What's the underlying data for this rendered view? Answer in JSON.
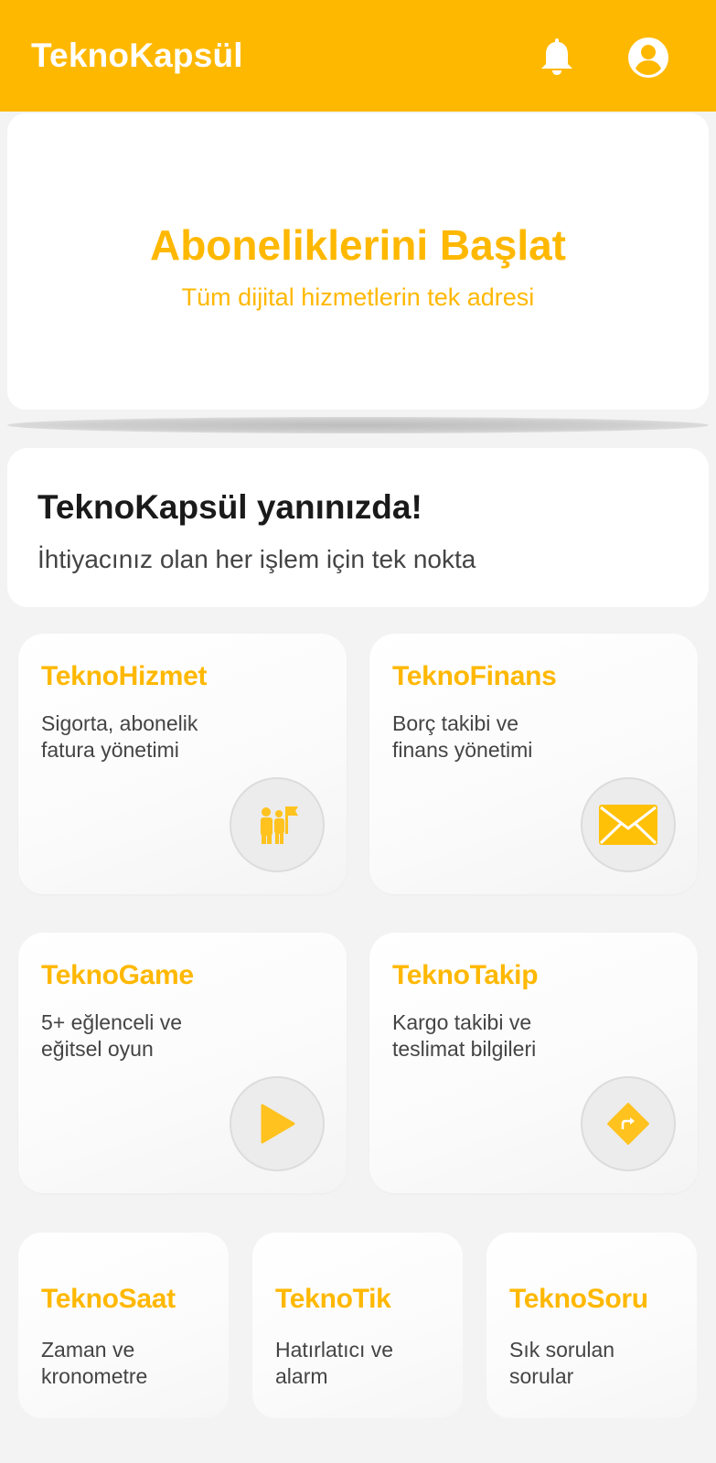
{
  "appbar": {
    "title": "TeknoKapsül",
    "icons": [
      "bell-icon",
      "account-circle-icon"
    ],
    "color": "#FFB800"
  },
  "hero": {
    "title": "Aboneliklerini Başlat",
    "subtitle": "Tüm dijital hizmetlerin tek adresi"
  },
  "welcome": {
    "title": "TeknoKapsül yanınızda!",
    "subtitle": "İhtiyacınız olan her işlem için tek nokta"
  },
  "services": [
    {
      "title": "TeknoHizmet",
      "desc": [
        "Sigorta, abonelik",
        "fatura yönetimi"
      ],
      "icon": "people-flag-icon"
    },
    {
      "title": "TeknoFinans",
      "desc": [
        "Borç takibi ve",
        "finans yönetimi"
      ],
      "icon": "envelope-icon"
    },
    {
      "title": "TeknoGame",
      "desc": [
        "5+ eğlenceli ve",
        "eğitsel oyun"
      ],
      "icon": "play-icon"
    },
    {
      "title": "TeknoTakip",
      "desc": [
        "Kargo takibi ve",
        "teslimat bilgileri"
      ],
      "icon": "directions-icon"
    }
  ],
  "mini_services": [
    {
      "title": "TeknoSaat",
      "desc": [
        "Zaman ve",
        "kronometre"
      ]
    },
    {
      "title": "TeknoTik",
      "desc": [
        "Hatırlatıcı ve",
        "alarm"
      ]
    },
    {
      "title": "TeknoSoru",
      "desc": [
        "Sık sorulan",
        "sorular"
      ]
    }
  ]
}
